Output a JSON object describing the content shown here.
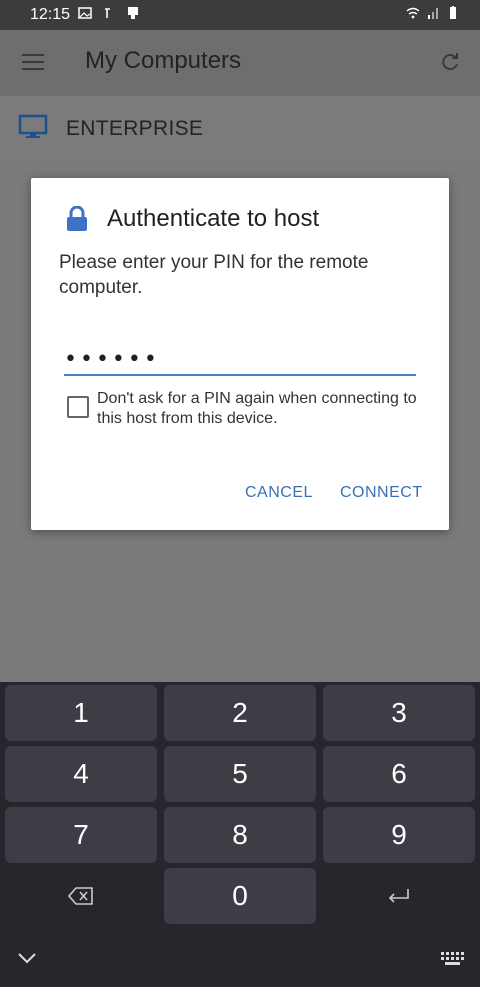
{
  "status_bar": {
    "time": "12:15"
  },
  "app_bar": {
    "title": "My Computers"
  },
  "host_list": {
    "items": [
      {
        "name": "ENTERPRISE"
      }
    ]
  },
  "dialog": {
    "title": "Authenticate to host",
    "message": "Please enter your PIN for the remote computer.",
    "pin_value": "••••••",
    "checkbox_label": "Don't ask for a PIN again when connecting to this host from this device.",
    "checkbox_checked": false,
    "cancel_label": "CANCEL",
    "connect_label": "CONNECT"
  },
  "keyboard": {
    "keys": [
      "1",
      "2",
      "3",
      "4",
      "5",
      "6",
      "7",
      "8",
      "9",
      "0"
    ]
  },
  "colors": {
    "accent": "#3a6fb5",
    "input_underline": "#4a7fc1",
    "keyboard_bg": "#26272d",
    "key_bg": "#3d3e45"
  }
}
